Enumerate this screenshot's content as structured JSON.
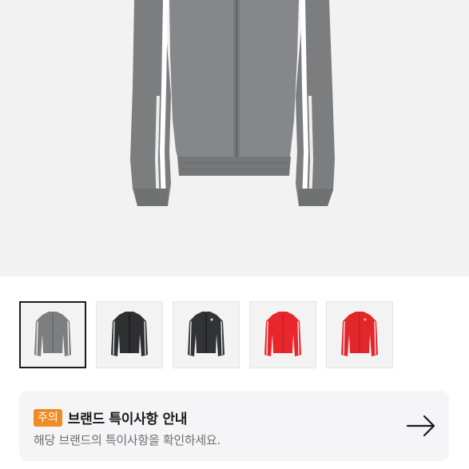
{
  "product": {
    "main_image": "grey-track-jacket-photo",
    "colors": {
      "hero_background": "#f2f2f2",
      "jacket_grey": "#7b7d7f",
      "stripe_white": "#ffffff",
      "badge_orange": "#f08a24",
      "card_background": "#f5f5f7"
    }
  },
  "thumbnails": [
    {
      "variant": "grey",
      "color": "#7c7e80",
      "selected": true
    },
    {
      "variant": "black",
      "color": "#2e2f31",
      "selected": false
    },
    {
      "variant": "black-alt",
      "color": "#323335",
      "selected": false
    },
    {
      "variant": "red",
      "color": "#e8262b",
      "selected": false
    },
    {
      "variant": "red-alt",
      "color": "#e2272c",
      "selected": false
    }
  ],
  "notice": {
    "badge": "주의",
    "title": "브랜드 특이사항 안내",
    "subtitle": "해당 브랜드의 특이사항을 확인하세요.",
    "arrow_icon": "arrow-right-icon"
  }
}
